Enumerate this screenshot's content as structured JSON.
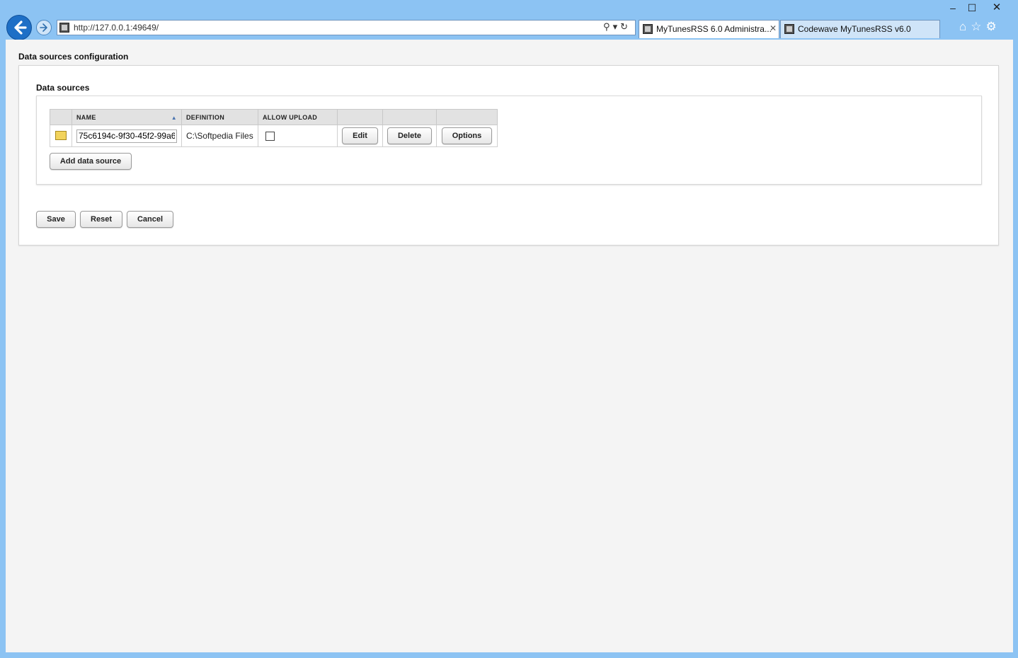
{
  "window": {
    "minimize": "–",
    "maximize": "☐",
    "close": "✕"
  },
  "browser": {
    "url": "http://127.0.0.1:49649/",
    "addr_tools": "⚲▾↻",
    "tabs": [
      {
        "label": "MyTunesRSS 6.0 Administra...",
        "close": "✕",
        "active": true
      },
      {
        "label": "Codewave MyTunesRSS v6.0",
        "active": false
      }
    ],
    "icons": [
      "home-icon",
      "favorites-icon",
      "settings-icon"
    ],
    "icon_glyphs": "⌂☆⚙"
  },
  "page": {
    "title": "Data sources configuration",
    "section_title": "Data sources",
    "table": {
      "headers": [
        "NAME",
        "DEFINITION",
        "ALLOW UPLOAD"
      ],
      "sort_indicator": "▲",
      "rows": [
        {
          "name": "75c6194c-9f30-45f2-99a6",
          "definition": "C:\\Softpedia Files",
          "allow_upload": false,
          "edit_label": "Edit",
          "delete_label": "Delete",
          "options_label": "Options"
        }
      ]
    },
    "add_label": "Add data source",
    "save_label": "Save",
    "reset_label": "Reset",
    "cancel_label": "Cancel"
  },
  "colors": {
    "chrome": "#8cc3f3",
    "page_bg": "#f4f4f4",
    "accent": "#1e6fc6"
  }
}
